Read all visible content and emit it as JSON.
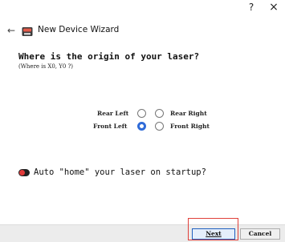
{
  "window": {
    "help_glyph": "?",
    "close_glyph": "×"
  },
  "header": {
    "back_glyph": "←",
    "title": "New Device Wizard",
    "icon": "laser-app-icon"
  },
  "main": {
    "question": "Where is the origin of your laser?",
    "subquestion": "(Where is X0, Y0 ?)",
    "origin_options": {
      "rear_left": "Rear Left",
      "rear_right": "Rear Right",
      "front_left": "Front Left",
      "front_right": "Front Right",
      "selected": "Front Left"
    },
    "home_toggle": {
      "label": "Auto \"home\" your laser on startup?",
      "on": false
    }
  },
  "footer": {
    "next_label": "Next",
    "cancel_label": "Cancel"
  },
  "colors": {
    "radio_selected": "#2f6bd8",
    "highlight_box": "#e0403a",
    "toggle_knob": "#e23b3b"
  }
}
